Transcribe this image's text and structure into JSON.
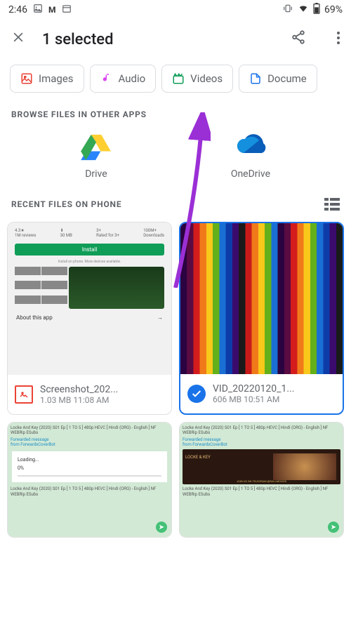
{
  "statusbar": {
    "time": "2:46",
    "battery": "69%"
  },
  "header": {
    "title": "1 selected"
  },
  "chips": [
    {
      "label": "Images",
      "color": "#ea4335"
    },
    {
      "label": "Audio",
      "color": "#d946ef"
    },
    {
      "label": "Videos",
      "color": "#0f9d58"
    },
    {
      "label": "Docume",
      "color": "#1a73e8"
    }
  ],
  "sections": {
    "browse_apps": "BROWSE FILES IN OTHER APPS",
    "recent": "RECENT FILES ON PHONE"
  },
  "apps": [
    {
      "label": "Drive"
    },
    {
      "label": "OneDrive"
    }
  ],
  "files": [
    {
      "name": "Screenshot_202...",
      "size": "1.03 MB",
      "time": "11:08 AM",
      "selected": false,
      "thumb": "playstore",
      "about": "About this app",
      "install": "Install",
      "install_caption": "Install on phone. More devices available.",
      "badges": {
        "rating": "4.3★",
        "reviews": "1M reviews",
        "size": "30 MB",
        "rated": "Rated for 3+",
        "downloads": "100M+",
        "dl_label": "Downloads"
      }
    },
    {
      "name": "VID_20220120_1...",
      "size": "606 MB",
      "time": "10:51 AM",
      "selected": true,
      "thumb": "stripes"
    },
    {
      "thumb": "chat-loading",
      "chat_title": "Locke And Key (2020) S01 Ep [ 1 TO 5 ] 480p HEVC [ Hindi (ORG) - English ] NF WEBRip ESubs",
      "fwd": "Forwarded message",
      "fwd_from": "from ForwardsCoverBot",
      "loading": "Loading...",
      "loading_pct": "0%"
    },
    {
      "thumb": "chat-banner",
      "chat_title": "Locke And Key (2020) S01 Ep [ 1 TO 5 ] 480p HEVC [ Hindi (ORG) - English ] NF WEBRip ESubs",
      "fwd": "Forwarded message",
      "fwd_from": "from ForwardsCoverBot",
      "banner_title": "LOCKE & KEY",
      "banner_sub": "JOIN US ON TELEGRAM   @BULLMOVIES"
    }
  ]
}
